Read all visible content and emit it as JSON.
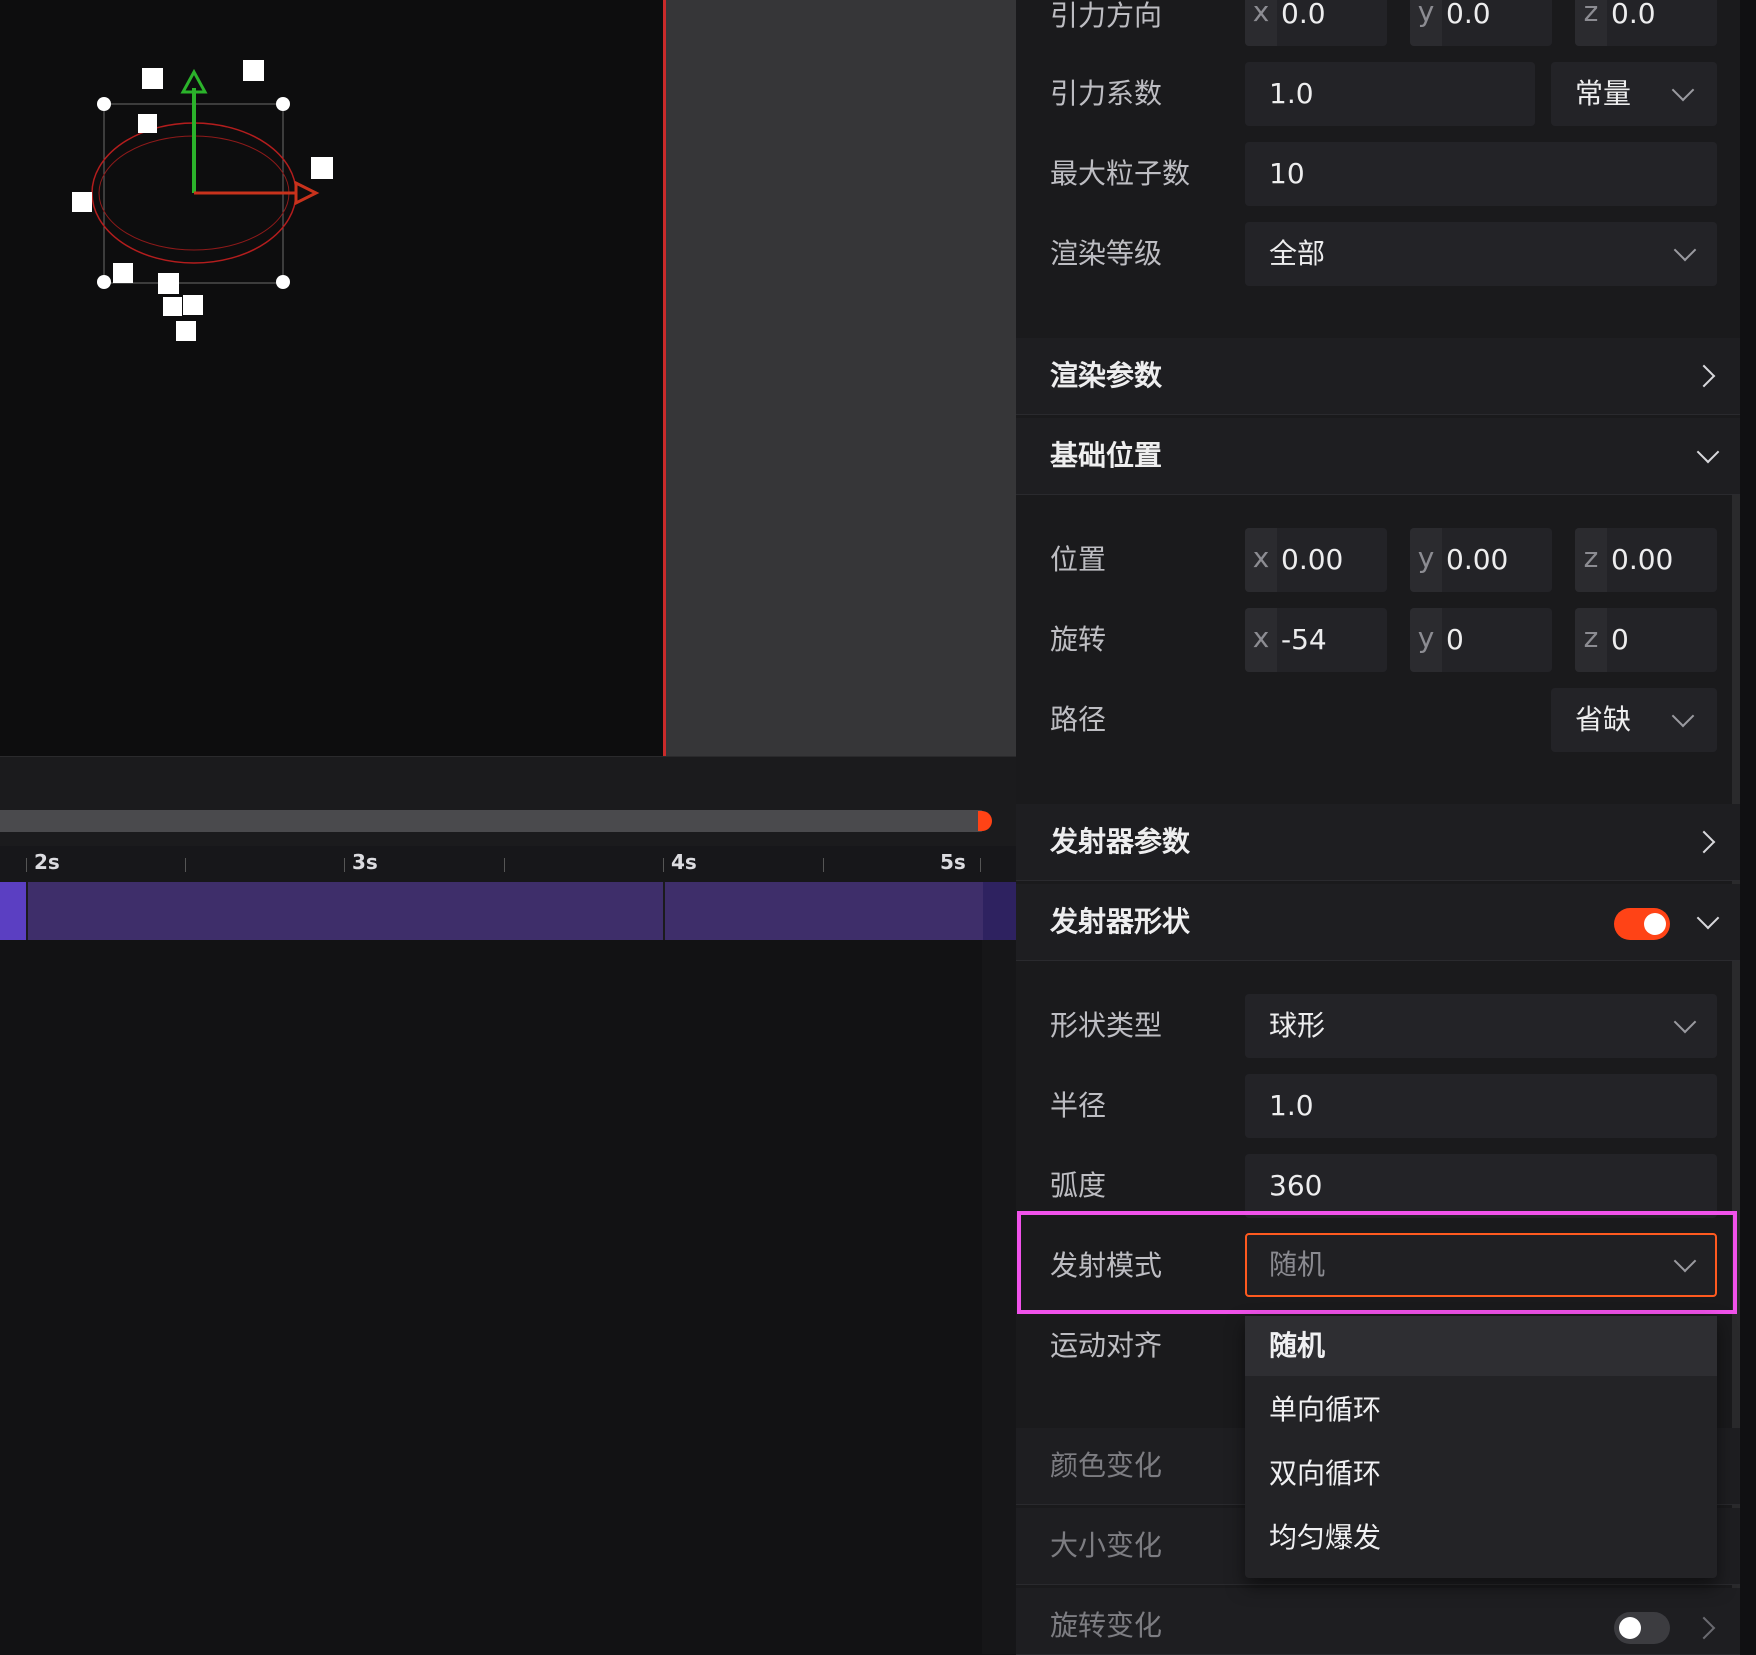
{
  "properties": {
    "gravity_direction": {
      "label": "引力方向",
      "x": "0.0",
      "y": "0.0",
      "z": "0.0"
    },
    "gravity_factor": {
      "label": "引力系数",
      "value": "1.0",
      "mode": "常量"
    },
    "max_particles": {
      "label": "最大粒子数",
      "value": "10"
    },
    "render_level": {
      "label": "渲染等级",
      "value": "全部"
    },
    "render_params": {
      "title": "渲染参数"
    },
    "base_position": {
      "title": "基础位置"
    },
    "position": {
      "label": "位置",
      "x": "0.00",
      "y": "0.00",
      "z": "0.00"
    },
    "rotation": {
      "label": "旋转",
      "x": "-54",
      "y": "0",
      "z": "0"
    },
    "path": {
      "label": "路径",
      "value": "省缺"
    },
    "emitter_params": {
      "title": "发射器参数"
    },
    "emitter_shape": {
      "title": "发射器形状",
      "enabled": true
    },
    "shape_type": {
      "label": "形状类型",
      "value": "球形"
    },
    "radius": {
      "label": "半径",
      "value": "1.0"
    },
    "arc": {
      "label": "弧度",
      "value": "360"
    },
    "emit_mode": {
      "label": "发射模式",
      "value": "随机",
      "options": [
        "随机",
        "单向循环",
        "双向循环",
        "均匀爆发"
      ]
    },
    "motion_align": {
      "label": "运动对齐"
    },
    "color_change": {
      "label": "颜色变化"
    },
    "size_change": {
      "label": "大小变化"
    },
    "rotation_change": {
      "label": "旋转变化",
      "enabled": false
    },
    "axis_labels": {
      "x": "x",
      "y": "y",
      "z": "z"
    }
  },
  "timeline": {
    "ticks": [
      "2s",
      "3s",
      "4s",
      "5s"
    ]
  },
  "colors": {
    "accent": "#ff4316",
    "highlight": "#f052ea",
    "track": "#3e2e6a",
    "gizmo_y": "#2bb32b",
    "gizmo_x": "#d8341c"
  }
}
